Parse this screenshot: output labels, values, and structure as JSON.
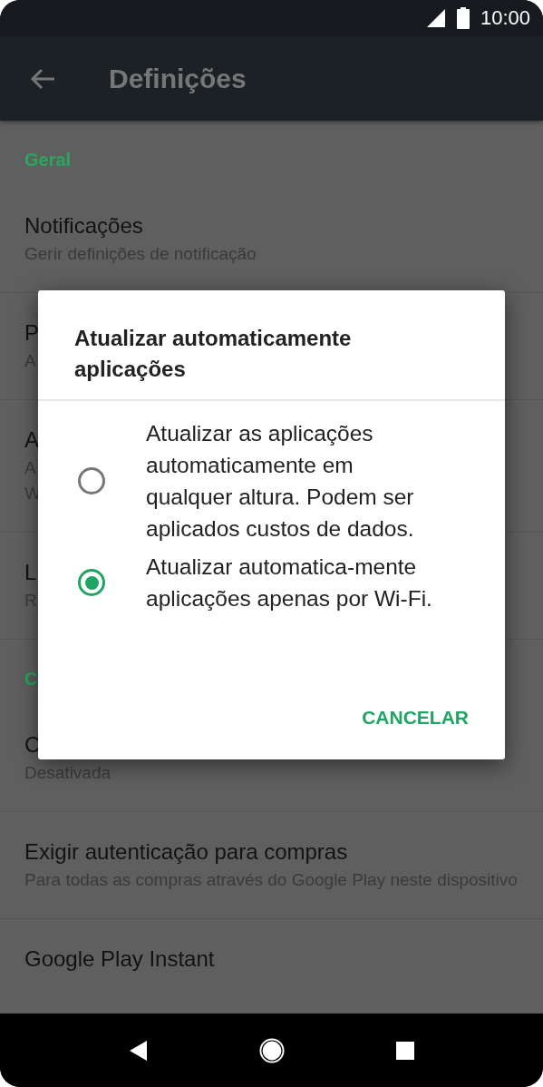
{
  "status_bar": {
    "time": "10:00"
  },
  "toolbar": {
    "title": "Definições"
  },
  "sections": [
    {
      "header": "Geral",
      "items": [
        {
          "title": "Notificações",
          "subtitle_lines": [
            "Gerir definições de notificação"
          ]
        },
        {
          "title": "P",
          "subtitle_lines": [
            "A"
          ]
        },
        {
          "title": "A",
          "subtitle_lines": [
            "A",
            "W"
          ]
        },
        {
          "title": "L",
          "subtitle_lines": [
            "R"
          ]
        }
      ]
    },
    {
      "header": "C",
      "items": [
        {
          "title": "C",
          "subtitle_lines": [
            "Desativada"
          ]
        },
        {
          "title": "Exigir autenticação para compras",
          "subtitle_lines": [
            "Para todas as compras através do Google Play neste dispositivo"
          ]
        },
        {
          "title": "Google Play Instant"
        }
      ]
    }
  ],
  "dialog": {
    "title": "Atualizar automaticamente aplicações",
    "options": [
      {
        "label": "Atualizar as aplicações automaticamente em qualquer altura. Podem ser aplicados custos de dados.",
        "selected": false
      },
      {
        "label": "Atualizar automatica-mente aplicações apenas por Wi-Fi.",
        "selected": true
      }
    ],
    "buttons": [
      "CANCELAR"
    ]
  }
}
